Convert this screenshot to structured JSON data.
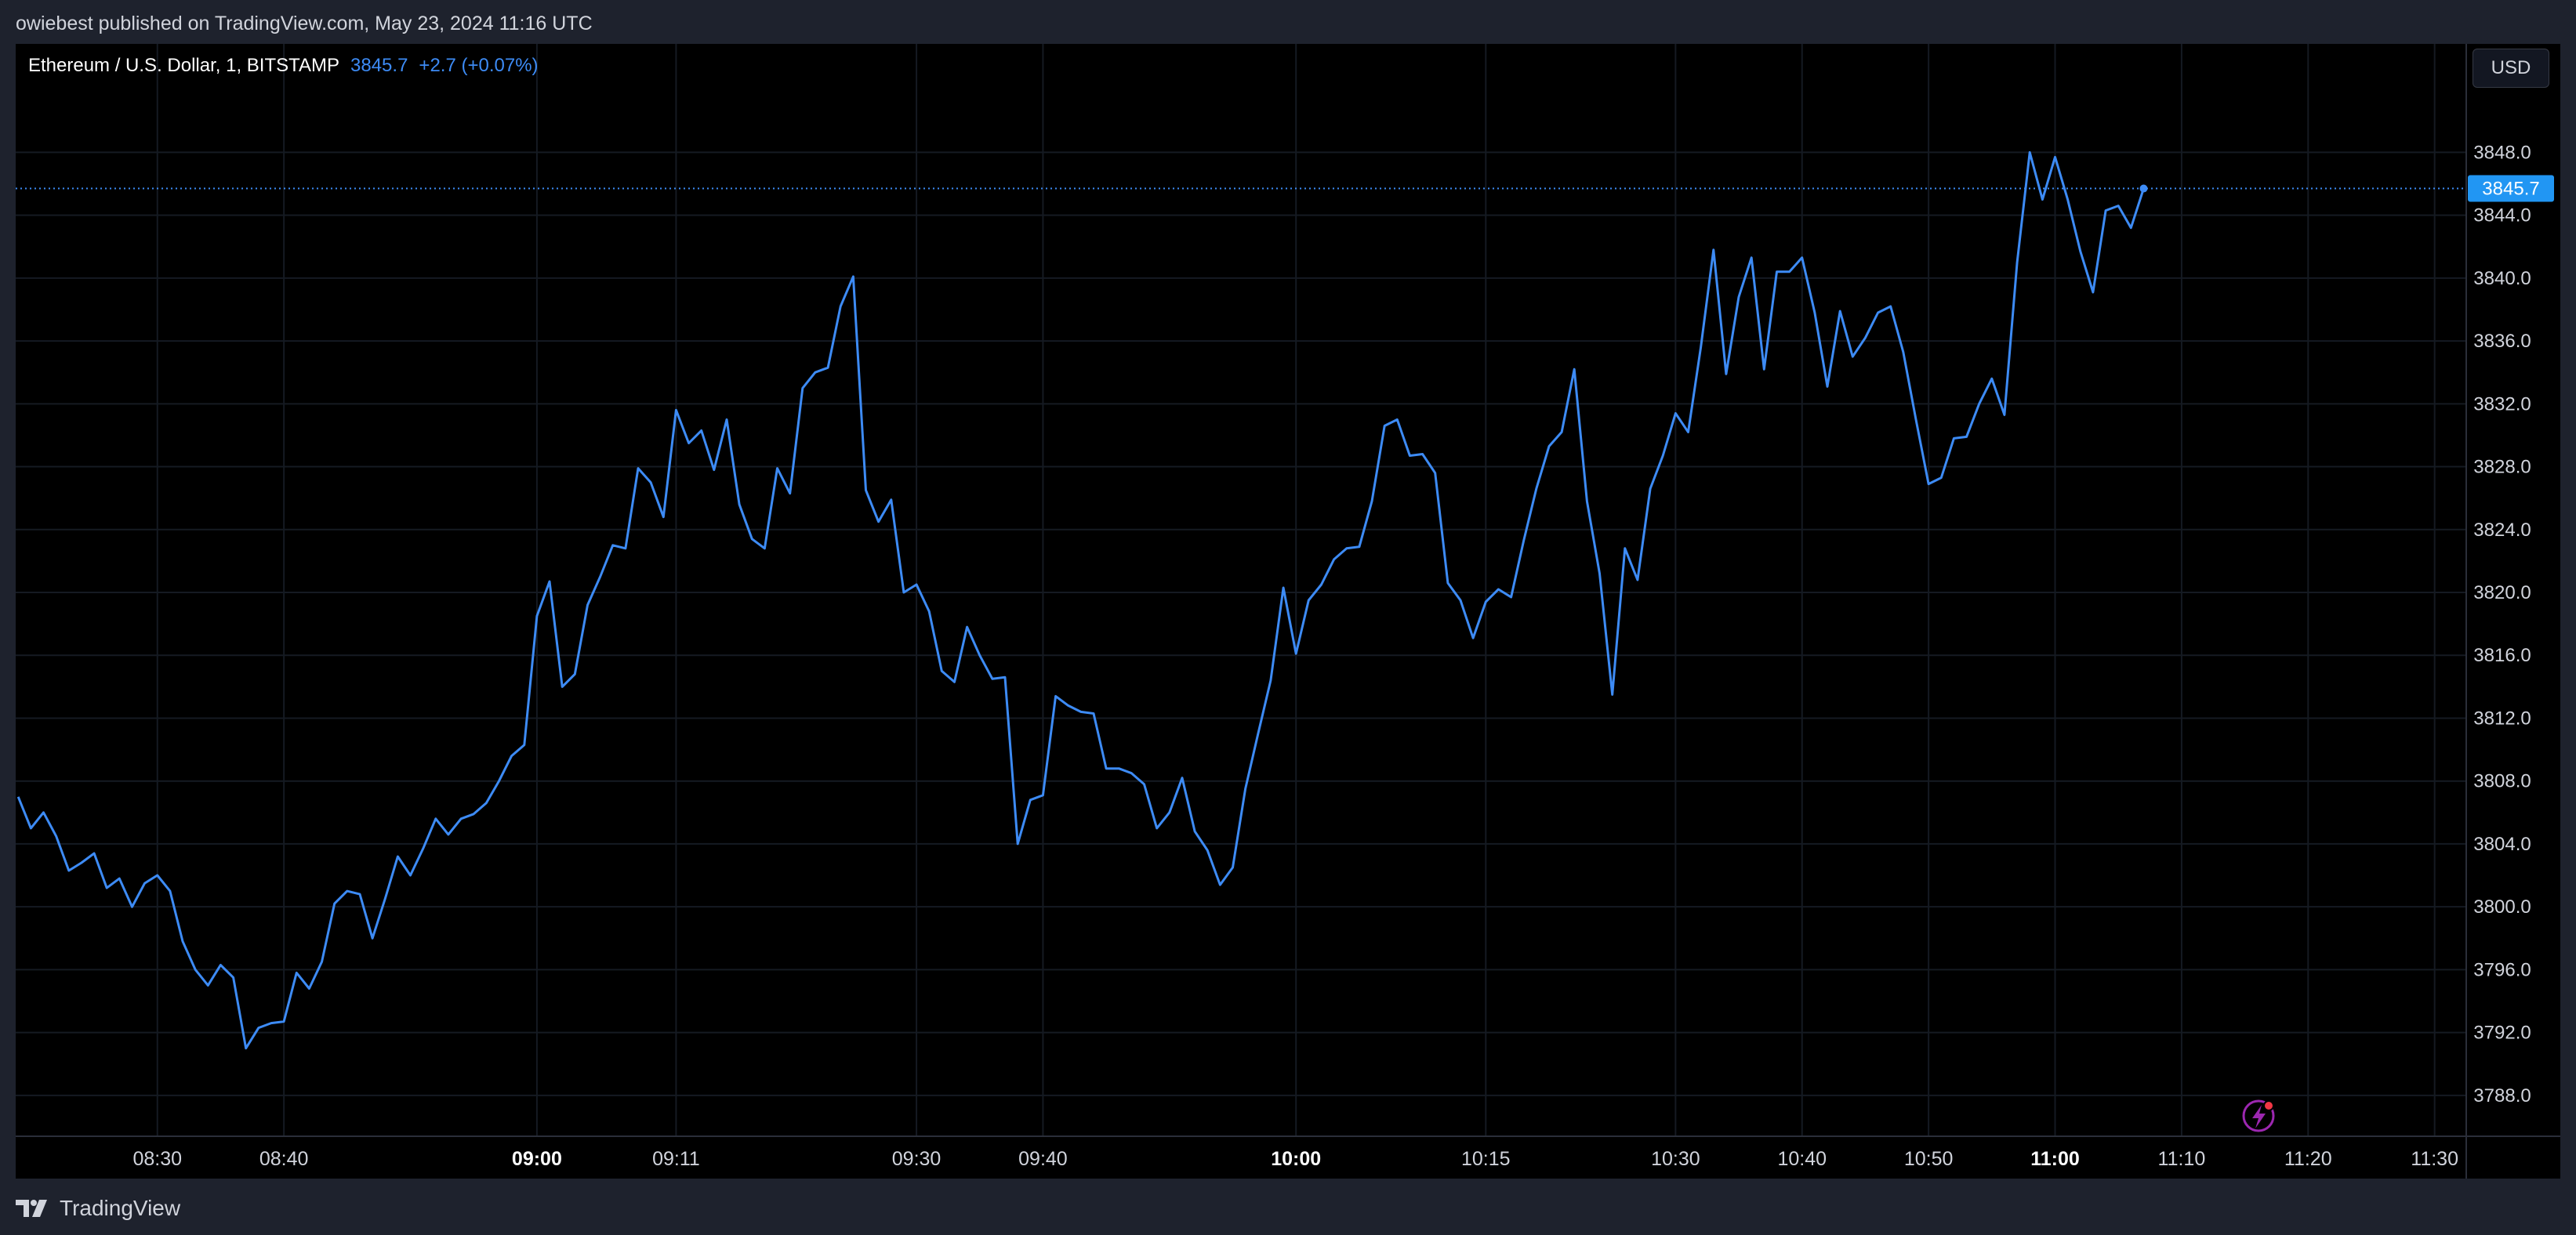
{
  "header": {
    "publish_line": "owiebest published on TradingView.com, May 23, 2024 11:16 UTC"
  },
  "legend": {
    "symbol": "Ethereum / U.S. Dollar, 1, BITSTAMP",
    "price": "3845.7",
    "change": "+2.7 (+0.07%)"
  },
  "currency_button": "USD",
  "footer": {
    "brand": "TradingView"
  },
  "colors": {
    "line": "#3d8bf5",
    "price_tag_bg": "#2196f3",
    "grid": "#151a22",
    "background": "#000000",
    "frame": "#1e222d",
    "alert_icon": "#9c27b0"
  },
  "icons": [
    "tradingview-logo-icon",
    "lightning-alert-icon"
  ],
  "chart_data": {
    "type": "line",
    "title": "Ethereum / U.S. Dollar, 1, BITSTAMP",
    "ylim": [
      3785.4,
      3854.9
    ],
    "y_ticks": [
      "3848.0",
      "3844.0",
      "3840.0",
      "3836.0",
      "3832.0",
      "3828.0",
      "3824.0",
      "3820.0",
      "3816.0",
      "3812.0",
      "3808.0",
      "3804.0",
      "3800.0",
      "3796.0",
      "3792.0",
      "3788.0"
    ],
    "x_ticks": [
      {
        "label": "08:30",
        "minute": 510,
        "bold": false
      },
      {
        "label": "08:40",
        "minute": 520,
        "bold": false
      },
      {
        "label": "09:00",
        "minute": 540,
        "bold": true
      },
      {
        "label": "09:11",
        "minute": 551,
        "bold": false
      },
      {
        "label": "09:30",
        "minute": 570,
        "bold": false
      },
      {
        "label": "09:40",
        "minute": 580,
        "bold": false
      },
      {
        "label": "10:00",
        "minute": 600,
        "bold": true
      },
      {
        "label": "10:15",
        "minute": 615,
        "bold": false
      },
      {
        "label": "10:30",
        "minute": 630,
        "bold": false
      },
      {
        "label": "10:40",
        "minute": 640,
        "bold": false
      },
      {
        "label": "10:50",
        "minute": 650,
        "bold": false
      },
      {
        "label": "11:00",
        "minute": 660,
        "bold": true
      },
      {
        "label": "11:10",
        "minute": 670,
        "bold": false
      },
      {
        "label": "11:20",
        "minute": 680,
        "bold": false
      },
      {
        "label": "11:30",
        "minute": 690,
        "bold": false
      }
    ],
    "last_price_label": "3845.7",
    "last_price": 3845.7,
    "grid": true,
    "series": [
      {
        "values": [
          [
            499,
            3807.0
          ],
          [
            500,
            3805.0
          ],
          [
            501,
            3806.0
          ],
          [
            502,
            3804.5
          ],
          [
            503,
            3802.3
          ],
          [
            504,
            3802.8
          ],
          [
            505,
            3803.4
          ],
          [
            506,
            3801.2
          ],
          [
            507,
            3801.8
          ],
          [
            508,
            3800.0
          ],
          [
            509,
            3801.5
          ],
          [
            510,
            3802.0
          ],
          [
            511,
            3801.0
          ],
          [
            512,
            3797.8
          ],
          [
            513,
            3796.0
          ],
          [
            514,
            3795.0
          ],
          [
            515,
            3796.3
          ],
          [
            516,
            3795.5
          ],
          [
            517,
            3791.0
          ],
          [
            518,
            3792.3
          ],
          [
            519,
            3792.6
          ],
          [
            520,
            3792.7
          ],
          [
            521,
            3795.8
          ],
          [
            522,
            3794.8
          ],
          [
            523,
            3796.5
          ],
          [
            524,
            3800.2
          ],
          [
            525,
            3801.0
          ],
          [
            526,
            3800.8
          ],
          [
            527,
            3798.0
          ],
          [
            528,
            3800.5
          ],
          [
            529,
            3803.2
          ],
          [
            530,
            3802.0
          ],
          [
            531,
            3803.7
          ],
          [
            532,
            3805.6
          ],
          [
            533,
            3804.6
          ],
          [
            534,
            3805.6
          ],
          [
            535,
            3805.9
          ],
          [
            536,
            3806.6
          ],
          [
            537,
            3808.0
          ],
          [
            538,
            3809.6
          ],
          [
            539,
            3810.3
          ],
          [
            540,
            3818.5
          ],
          [
            541,
            3820.7
          ],
          [
            542,
            3814.0
          ],
          [
            543,
            3814.8
          ],
          [
            544,
            3819.2
          ],
          [
            545,
            3821.0
          ],
          [
            546,
            3823.0
          ],
          [
            547,
            3822.8
          ],
          [
            548,
            3827.9
          ],
          [
            549,
            3827.0
          ],
          [
            550,
            3824.8
          ],
          [
            551,
            3831.6
          ],
          [
            552,
            3829.5
          ],
          [
            553,
            3830.3
          ],
          [
            554,
            3827.8
          ],
          [
            555,
            3831.0
          ],
          [
            556,
            3825.6
          ],
          [
            557,
            3823.4
          ],
          [
            558,
            3822.8
          ],
          [
            559,
            3827.9
          ],
          [
            560,
            3826.3
          ],
          [
            561,
            3833.0
          ],
          [
            562,
            3834.0
          ],
          [
            563,
            3834.3
          ],
          [
            564,
            3838.2
          ],
          [
            565,
            3840.1
          ],
          [
            566,
            3826.5
          ],
          [
            567,
            3824.5
          ],
          [
            568,
            3825.9
          ],
          [
            569,
            3820.0
          ],
          [
            570,
            3820.5
          ],
          [
            571,
            3818.8
          ],
          [
            572,
            3815.0
          ],
          [
            573,
            3814.3
          ],
          [
            574,
            3817.8
          ],
          [
            575,
            3816.0
          ],
          [
            576,
            3814.5
          ],
          [
            577,
            3814.6
          ],
          [
            578,
            3804.0
          ],
          [
            579,
            3806.8
          ],
          [
            580,
            3807.1
          ],
          [
            581,
            3813.4
          ],
          [
            582,
            3812.8
          ],
          [
            583,
            3812.4
          ],
          [
            584,
            3812.3
          ],
          [
            585,
            3808.8
          ],
          [
            586,
            3808.8
          ],
          [
            587,
            3808.5
          ],
          [
            588,
            3807.8
          ],
          [
            589,
            3805.0
          ],
          [
            590,
            3806.0
          ],
          [
            591,
            3808.2
          ],
          [
            592,
            3804.8
          ],
          [
            593,
            3803.6
          ],
          [
            594,
            3801.4
          ],
          [
            595,
            3802.5
          ],
          [
            596,
            3807.5
          ],
          [
            597,
            3811.0
          ],
          [
            598,
            3814.4
          ],
          [
            599,
            3820.3
          ],
          [
            600,
            3816.1
          ],
          [
            601,
            3819.5
          ],
          [
            602,
            3820.5
          ],
          [
            603,
            3822.1
          ],
          [
            604,
            3822.8
          ],
          [
            605,
            3822.9
          ],
          [
            606,
            3825.8
          ],
          [
            607,
            3830.6
          ],
          [
            608,
            3831.0
          ],
          [
            609,
            3828.7
          ],
          [
            610,
            3828.8
          ],
          [
            611,
            3827.6
          ],
          [
            612,
            3820.6
          ],
          [
            613,
            3819.5
          ],
          [
            614,
            3817.1
          ],
          [
            615,
            3819.4
          ],
          [
            616,
            3820.2
          ],
          [
            617,
            3819.7
          ],
          [
            618,
            3823.3
          ],
          [
            619,
            3826.6
          ],
          [
            620,
            3829.3
          ],
          [
            621,
            3830.2
          ],
          [
            622,
            3834.2
          ],
          [
            623,
            3825.8
          ],
          [
            624,
            3821.2
          ],
          [
            625,
            3813.5
          ],
          [
            626,
            3822.8
          ],
          [
            627,
            3820.8
          ],
          [
            628,
            3826.6
          ],
          [
            629,
            3828.7
          ],
          [
            630,
            3831.4
          ],
          [
            631,
            3830.2
          ],
          [
            632,
            3835.6
          ],
          [
            633,
            3841.8
          ],
          [
            634,
            3833.9
          ],
          [
            635,
            3838.8
          ],
          [
            636,
            3841.3
          ],
          [
            637,
            3834.2
          ],
          [
            638,
            3840.4
          ],
          [
            639,
            3840.4
          ],
          [
            640,
            3841.3
          ],
          [
            641,
            3837.8
          ],
          [
            642,
            3833.1
          ],
          [
            643,
            3837.9
          ],
          [
            644,
            3835.0
          ],
          [
            645,
            3836.2
          ],
          [
            646,
            3837.8
          ],
          [
            647,
            3838.2
          ],
          [
            648,
            3835.3
          ],
          [
            649,
            3831.0
          ],
          [
            650,
            3826.9
          ],
          [
            651,
            3827.3
          ],
          [
            652,
            3829.8
          ],
          [
            653,
            3829.9
          ],
          [
            654,
            3832.0
          ],
          [
            655,
            3833.6
          ],
          [
            656,
            3831.3
          ],
          [
            657,
            3841.0
          ],
          [
            658,
            3848.0
          ],
          [
            659,
            3845.0
          ],
          [
            660,
            3847.7
          ],
          [
            661,
            3845.0
          ],
          [
            662,
            3841.7
          ],
          [
            663,
            3839.1
          ],
          [
            664,
            3844.3
          ],
          [
            665,
            3844.6
          ],
          [
            666,
            3843.2
          ],
          [
            667,
            3845.7
          ]
        ]
      }
    ]
  }
}
